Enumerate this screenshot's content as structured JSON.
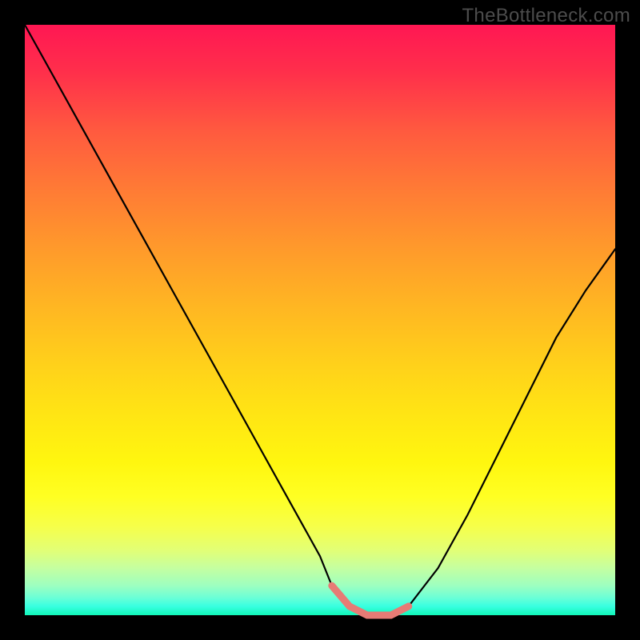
{
  "watermark": "TheBottleneck.com",
  "colors": {
    "frame": "#000000",
    "watermark": "#4c4c4c",
    "curve": "#000000",
    "highlight": "#e77b75",
    "gradient_top": "#ff1753",
    "gradient_bottom": "#11f7b8"
  },
  "chart_data": {
    "type": "line",
    "title": "",
    "xlabel": "",
    "ylabel": "",
    "xlim": [
      0,
      100
    ],
    "ylim": [
      0,
      100
    ],
    "grid": false,
    "legend": false,
    "series": [
      {
        "name": "bottleneck-curve",
        "x": [
          0,
          5,
          10,
          15,
          20,
          25,
          30,
          35,
          40,
          45,
          50,
          52,
          55,
          58,
          60,
          62,
          65,
          70,
          75,
          80,
          85,
          90,
          95,
          100
        ],
        "y": [
          100,
          91,
          82,
          73,
          64,
          55,
          46,
          37,
          28,
          19,
          10,
          5,
          1.5,
          0,
          0,
          0,
          1.5,
          8,
          17,
          27,
          37,
          47,
          55,
          62
        ]
      }
    ],
    "annotations": [
      {
        "name": "highlight-segment",
        "x_range": [
          52,
          65
        ],
        "color": "#e77b75"
      }
    ]
  }
}
